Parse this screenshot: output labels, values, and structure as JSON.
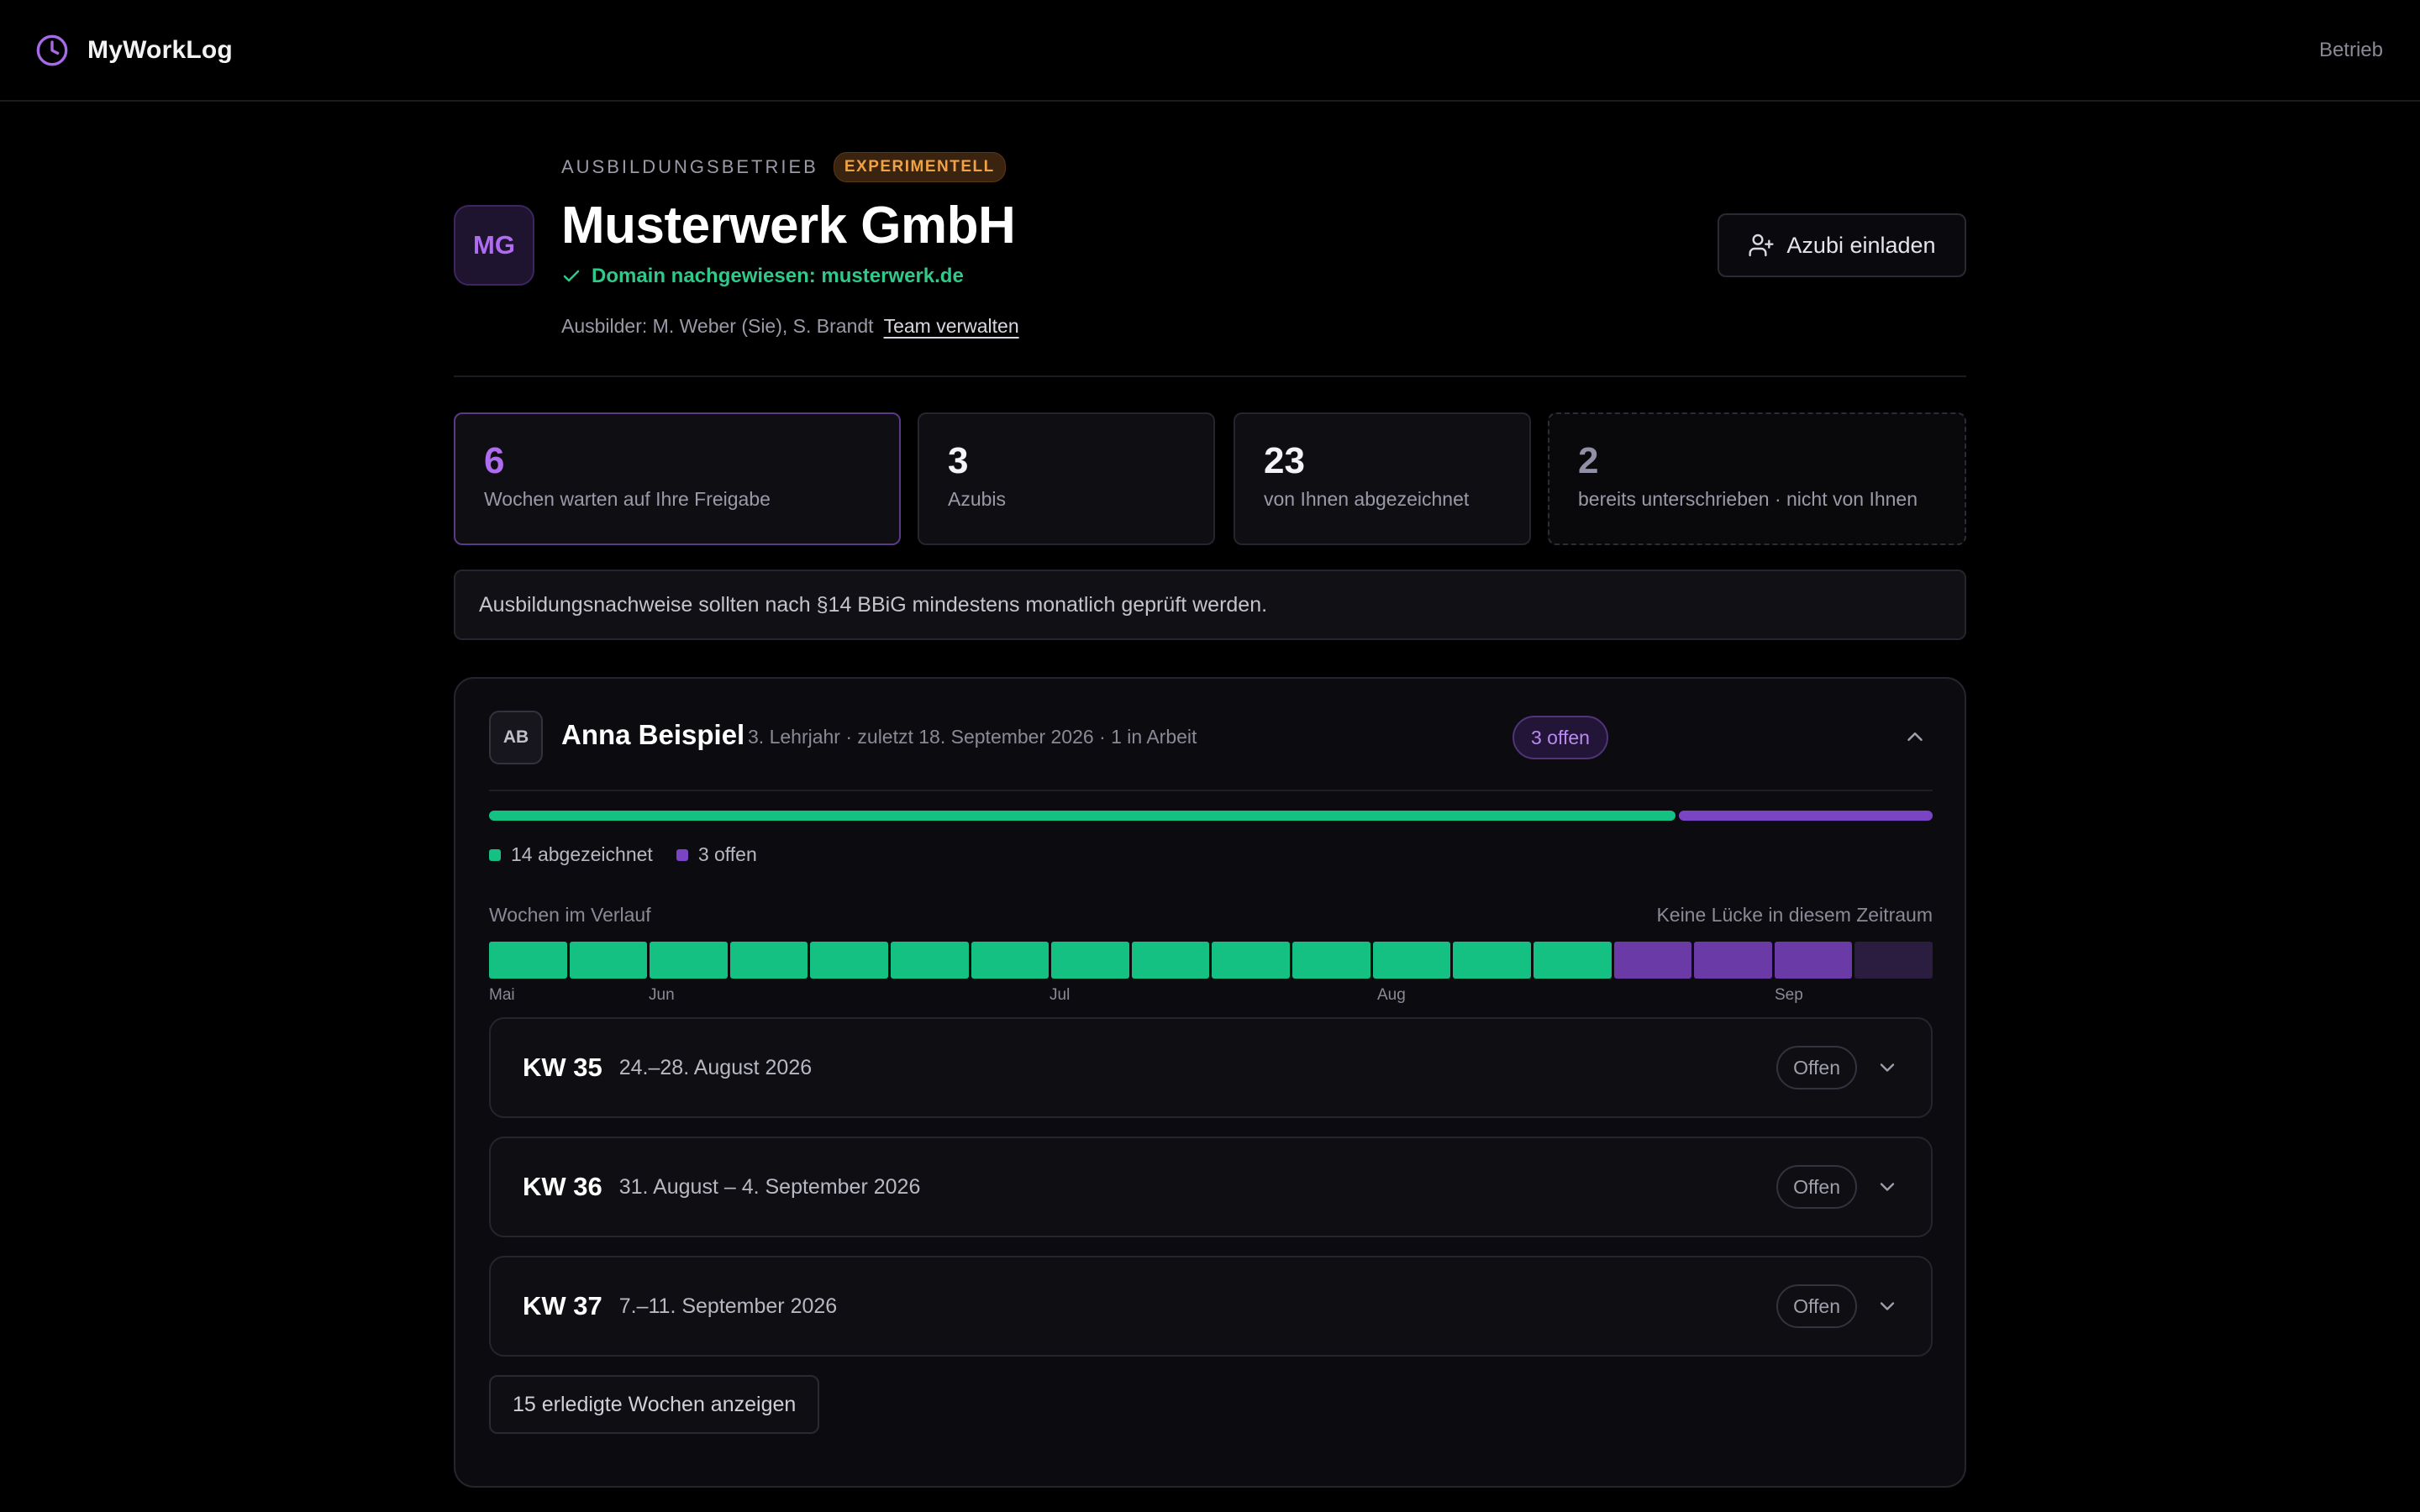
{
  "app": {
    "name": "MyWorkLog",
    "nav_link": "Betrieb"
  },
  "company": {
    "eyebrow": "Ausbildungsbetrieb",
    "badge": "Experimentell",
    "initials": "MG",
    "name": "Musterwerk GmbH",
    "verified": "Domain nachgewiesen: musterwerk.de",
    "trainers": "Ausbilder: M. Weber (Sie), S. Brandt",
    "team_link": "Team verwalten",
    "invite_button": "Azubi einladen"
  },
  "stats": [
    {
      "value": "6",
      "label": "Wochen warten auf Ihre Freigabe"
    },
    {
      "value": "3",
      "label": "Azubis"
    },
    {
      "value": "23",
      "label": "von Ihnen abgezeichnet"
    },
    {
      "value": "2",
      "label": "bereits unterschrieben · nicht von Ihnen"
    }
  ],
  "notice": "Ausbildungsnachweise sollten nach §14 BBiG mindestens monatlich geprüft werden.",
  "apprentice": {
    "initials": "AB",
    "name": "Anna Beispiel",
    "meta": "3. Lehrjahr · zuletzt 18. September 2026 · 1 in Arbeit",
    "open_badge": "3 offen",
    "signed_count": 14,
    "open_count": 3,
    "legend_signed": "14 abgezeichnet",
    "legend_open": "3 offen",
    "timeline_title": "Wochen im Verlauf",
    "timeline_note": "Keine Lücke in diesem Zeitraum",
    "weeks": [
      "done",
      "done",
      "done",
      "done",
      "done",
      "done",
      "done",
      "done",
      "done",
      "done",
      "done",
      "done",
      "done",
      "done",
      "open",
      "open",
      "open",
      "future"
    ],
    "months": [
      "Mai",
      "Jun",
      "Jul",
      "Aug",
      "Sep"
    ],
    "week_rows": [
      {
        "kw": "KW 35",
        "range": "24.–28. August 2026",
        "status": "Offen"
      },
      {
        "kw": "KW 36",
        "range": "31. August – 4. September 2026",
        "status": "Offen"
      },
      {
        "kw": "KW 37",
        "range": "7.–11. September 2026",
        "status": "Offen"
      }
    ],
    "show_done_button": "15 erledigte Wochen anzeigen"
  },
  "colors": {
    "accent": "#b06cf0",
    "success": "#14c082",
    "open": "#7b44c4",
    "warning": "#f0a244"
  }
}
